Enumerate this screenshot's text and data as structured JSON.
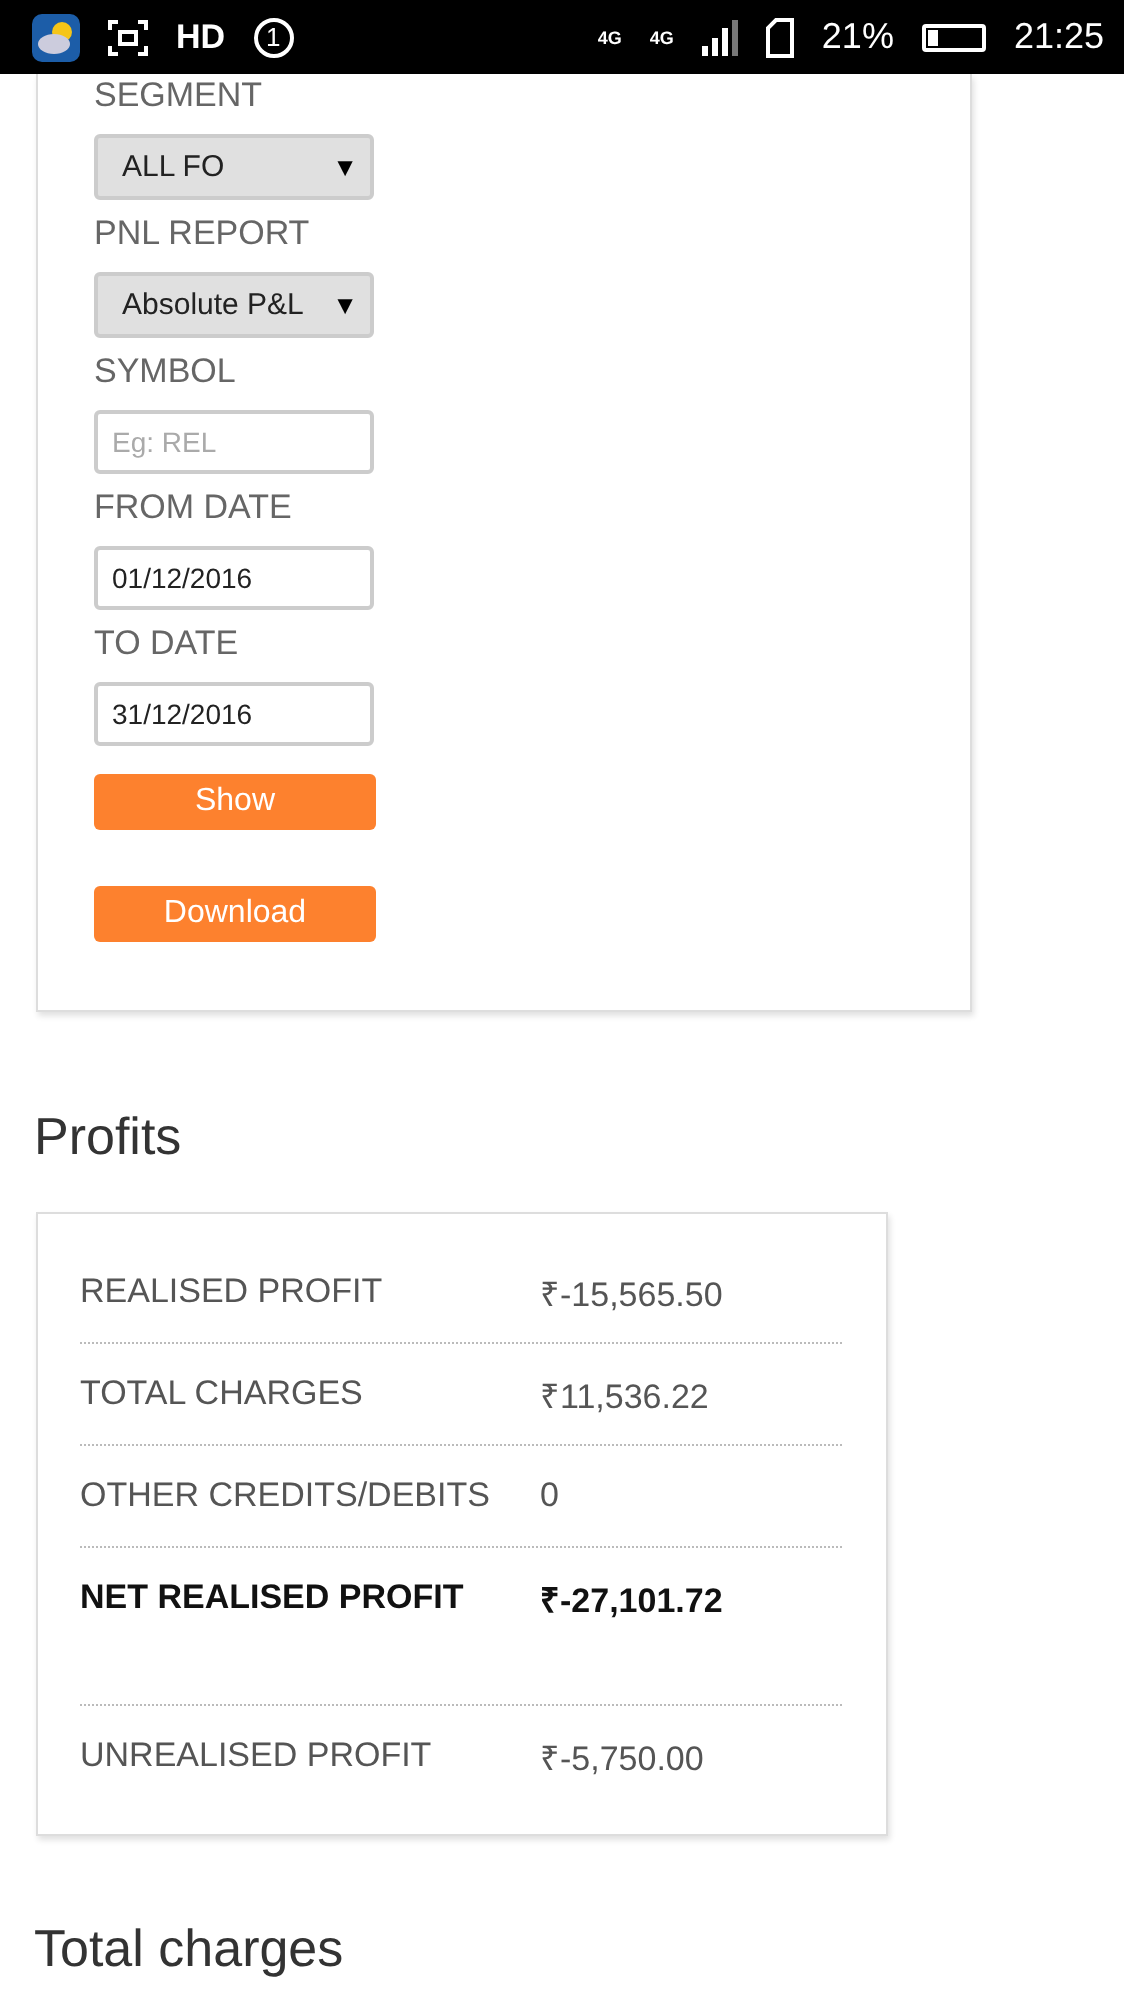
{
  "status_bar": {
    "hd": "HD",
    "notification_count": "1",
    "network_labels": [
      "4G",
      "4G"
    ],
    "battery": "21%",
    "time": "21:25"
  },
  "form": {
    "fields": [
      {
        "kind": "select",
        "label": "SEGMENT",
        "value": "ALL FO",
        "caret": "▼"
      },
      {
        "kind": "select",
        "label": "PNL REPORT",
        "value": "Absolute P&L",
        "caret": "▼"
      },
      {
        "kind": "input",
        "label": "SYMBOL",
        "placeholder": "Eg: REL"
      },
      {
        "kind": "input",
        "label": "FROM DATE",
        "value": "01/12/2016"
      },
      {
        "kind": "input",
        "label": "TO DATE",
        "value": "31/12/2016"
      }
    ],
    "buttons": [
      "Show",
      "Download"
    ]
  },
  "profits": {
    "title": "Profits",
    "rows": [
      {
        "label": "REALISED PROFIT",
        "value": "₹-15,565.50",
        "bold": false
      },
      {
        "label": "TOTAL CHARGES",
        "value": "₹11,536.22",
        "bold": false
      },
      {
        "label": "OTHER CREDITS/DEBITS",
        "value": "0",
        "bold": false
      },
      {
        "label": "NET REALISED PROFIT",
        "value": "₹-27,101.72",
        "bold": true
      },
      {
        "label": "UNREALISED PROFIT",
        "value": "₹-5,750.00",
        "bold": false
      }
    ]
  },
  "next_section": {
    "title": "Total charges"
  }
}
